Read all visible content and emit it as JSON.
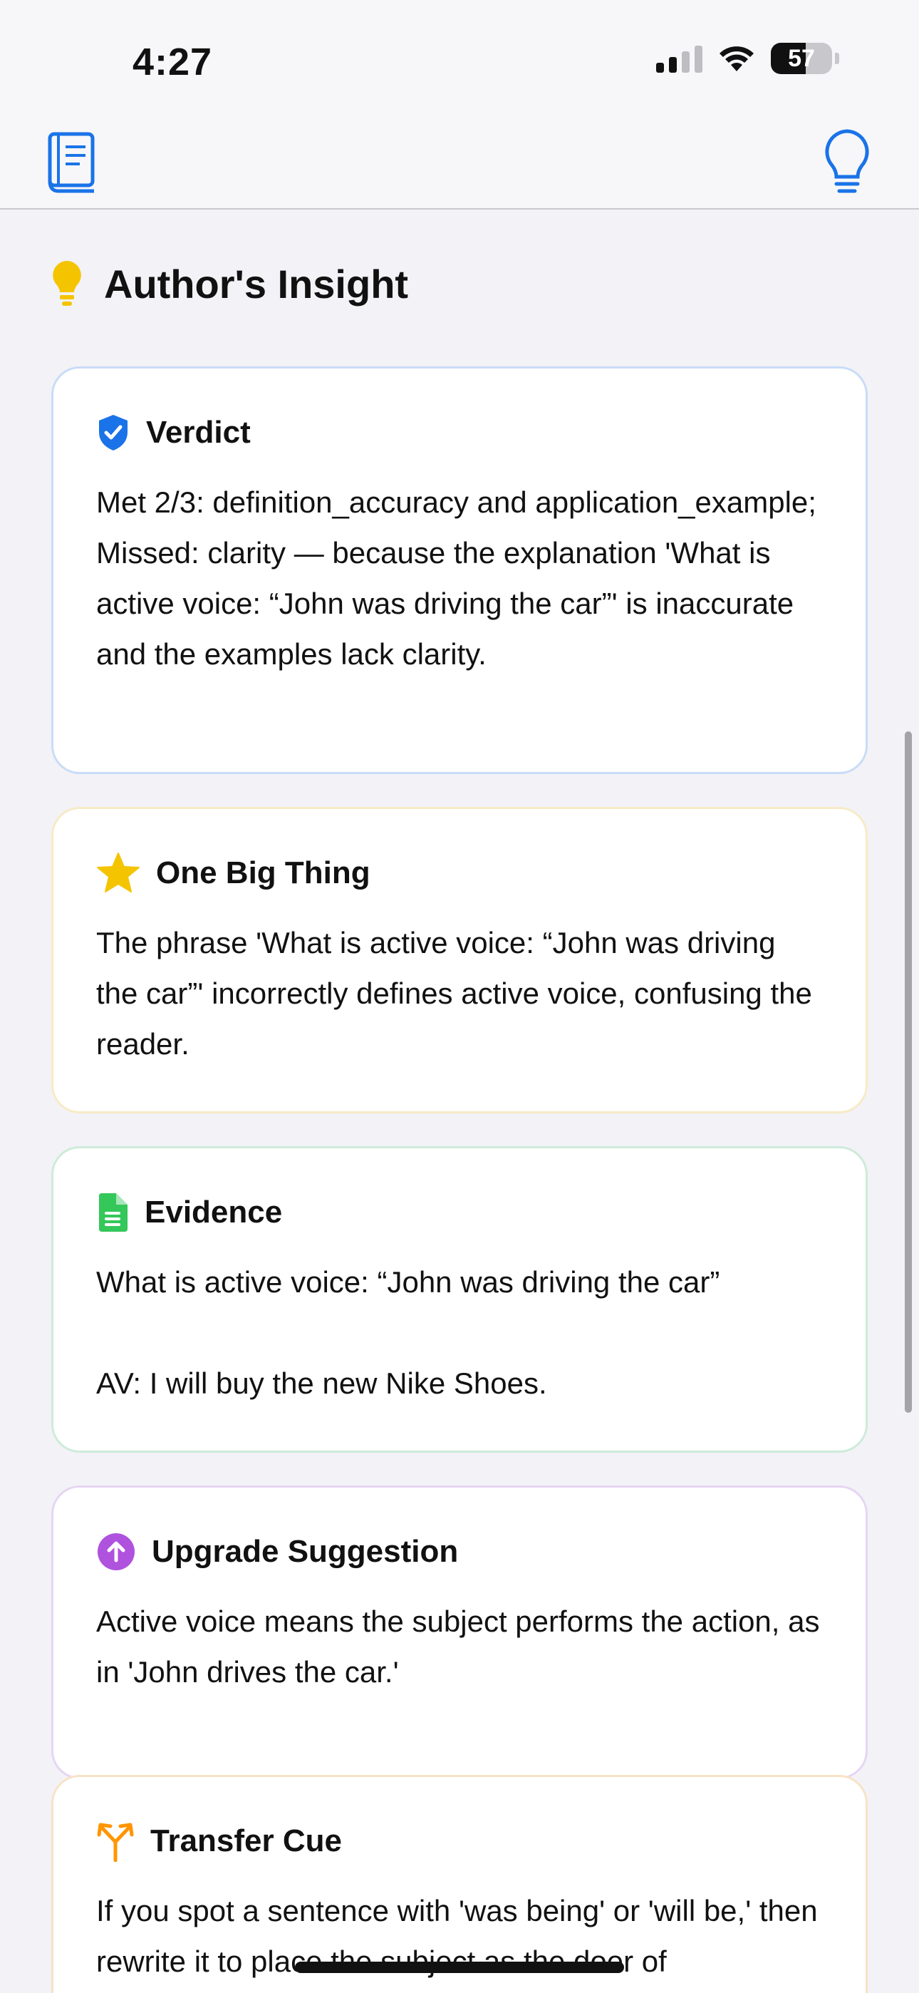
{
  "status_bar": {
    "time": "4:27",
    "battery_level": "57",
    "signal_bars": 2,
    "wifi": true
  },
  "nav": {
    "left_icon": "book-icon",
    "right_icon": "lightbulb-icon"
  },
  "header": {
    "icon": "lightbulb-icon",
    "title": "Author's Insight"
  },
  "cards": [
    {
      "title": "Verdict",
      "icon": "verified-shield-icon",
      "border_color": "#c9dcf7",
      "text": "Met 2/3: definition_accuracy and application_example; Missed: clarity — because the explanation 'What is active voice: “John was driving the car”' is inaccurate and the examples lack clarity."
    },
    {
      "title": "One Big Thing",
      "icon": "star-icon",
      "border_color": "#f7ebc6",
      "text": "The phrase 'What is active voice: “John was driving the car”' incorrectly defines active voice, confusing the reader."
    },
    {
      "title": "Evidence",
      "icon": "document-icon",
      "border_color": "#cdebd9",
      "text": "What is active voice: “John was driving the car”\n\nAV: I will buy the new Nike Shoes."
    },
    {
      "title": "Upgrade Suggestion",
      "icon": "arrow-up-circle-icon",
      "border_color": "#e7d5f3",
      "text": "Active voice means the subject performs the action, as in 'John drives the car.'"
    },
    {
      "title": "Transfer Cue",
      "icon": "branch-arrows-icon",
      "border_color": "#f7e3c6",
      "text": "If you spot a sentence with 'was being' or 'will be,' then rewrite it to place the subject as the doer of"
    }
  ],
  "colors": {
    "accent_blue": "#1a73e8",
    "star_yellow": "#f5c400",
    "evidence_green": "#34c759",
    "upgrade_purple": "#af52de",
    "transfer_orange": "#ff9500"
  }
}
